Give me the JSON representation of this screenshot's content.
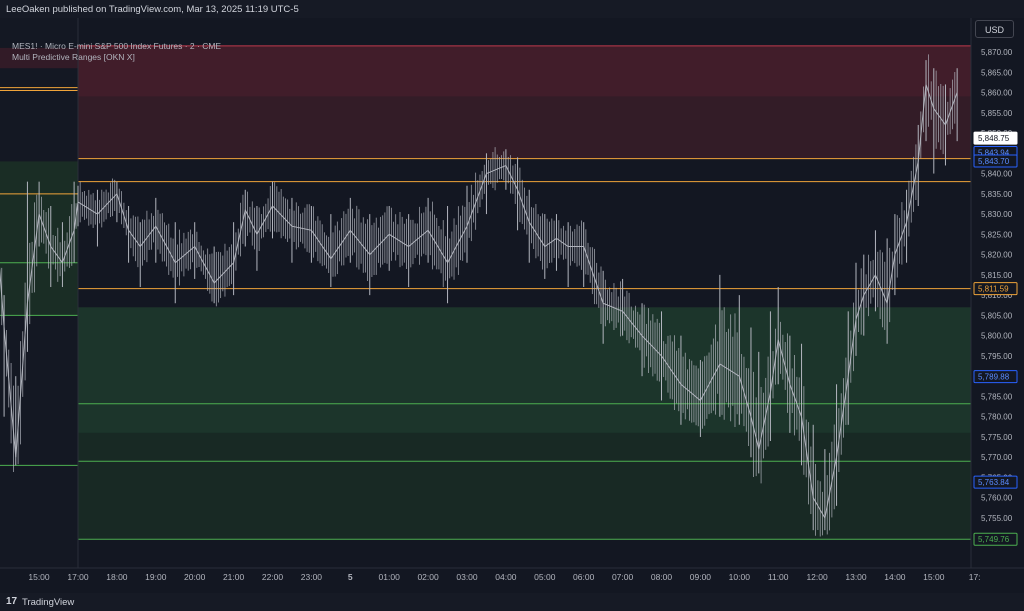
{
  "header": {
    "published_text": "LeeOaken published on TradingView.com, Mar 13, 2025 11:19 UTC-5"
  },
  "legend": {
    "symbol_line": "MES1! · Micro E-mini S&P 500 Index Futures · 2 · CME",
    "indicator_line": "Multi Predictive Ranges [OKN X]"
  },
  "toolbar": {
    "currency": "USD"
  },
  "footer": {
    "logo": "17",
    "brand": "TradingView"
  },
  "colors": {
    "background": "#131722",
    "price_line": "#b2b5be",
    "level_line": "#f0a43a",
    "resistance_zone": "#5a2430",
    "support_zone": "#1e3b2d",
    "support_line": "#4caf50",
    "blue_label": "#2962ff"
  },
  "chart_data": {
    "type": "line",
    "title": "MES1! · Micro E-mini S&P 500 Index Futures · 2 · CME",
    "x_ticks": [
      "15:00",
      "17:00",
      "18:00",
      "19:00",
      "20:00",
      "21:00",
      "22:00",
      "23:00",
      "5",
      "01:00",
      "02:00",
      "03:00",
      "04:00",
      "05:00",
      "06:00",
      "07:00",
      "08:00",
      "09:00",
      "10:00",
      "11:00",
      "12:00",
      "13:00",
      "14:00",
      "15:00",
      "17:"
    ],
    "y_ticks": [
      5755,
      5760,
      5765,
      5770,
      5775,
      5780,
      5785,
      5790,
      5795,
      5800,
      5805,
      5810,
      5815,
      5820,
      5825,
      5830,
      5835,
      5840,
      5845,
      5850,
      5855,
      5860,
      5865,
      5870
    ],
    "y_tick_labels": [
      "5,755.00",
      "5,760.00",
      "5,765.00",
      "5,770.00",
      "5,775.00",
      "5,780.00",
      "5,785.00",
      "5,790.00",
      "5,795.00",
      "5,800.00",
      "5,805.00",
      "5,810.00",
      "5,815.00",
      "5,820.00",
      "5,825.00",
      "5,830.00",
      "5,835.00",
      "5,840.00",
      "5,845.00",
      "5,850.00",
      "5,855.00",
      "5,860.00",
      "5,865.00",
      "5,870.00"
    ],
    "ylim": [
      5747,
      5874
    ],
    "series": [
      {
        "x": [
          14.2,
          14.5,
          14.8,
          15.1,
          15.4,
          15.7,
          16.0,
          16.3,
          16.6,
          16.9,
          17.0,
          17.5,
          18.0,
          18.3,
          18.6,
          19.0,
          19.5,
          20.0,
          20.5,
          21.0,
          21.3,
          21.6,
          22.0,
          22.5,
          23.0,
          23.5,
          24.0,
          24.5,
          25.0,
          25.5,
          26.0,
          26.5,
          27.0,
          27.5,
          28.0,
          28.3,
          28.6,
          29.0,
          29.3,
          29.6,
          30.0,
          30.5,
          31.0,
          31.5,
          32.0,
          32.5,
          33.0,
          33.5,
          34.0,
          34.3,
          34.5,
          34.8,
          35.0,
          35.3,
          35.6,
          35.9,
          36.2,
          36.5,
          36.8,
          37.0,
          37.2,
          37.5,
          37.8,
          38.0,
          38.3,
          38.6,
          38.8,
          39.0,
          39.3,
          39.6
        ],
        "y": [
          5850,
          5866,
          5840,
          5802,
          5770,
          5808,
          5830,
          5822,
          5818,
          5826,
          5833,
          5830,
          5835,
          5826,
          5822,
          5827,
          5818,
          5822,
          5813,
          5818,
          5831,
          5825,
          5832,
          5827,
          5826,
          5819,
          5826,
          5820,
          5825,
          5822,
          5826,
          5818,
          5827,
          5840,
          5842,
          5836,
          5828,
          5822,
          5824,
          5822,
          5822,
          5808,
          5806,
          5800,
          5795,
          5788,
          5784,
          5793,
          5790,
          5780,
          5772,
          5786,
          5799,
          5788,
          5780,
          5760,
          5755,
          5770,
          5790,
          5804,
          5810,
          5815,
          5808,
          5820,
          5828,
          5843,
          5862,
          5856,
          5852,
          5860
        ],
        "high": [
          5864,
          5870,
          5850,
          5810,
          5790,
          5838,
          5838,
          5832,
          5828,
          5838,
          5837,
          5836,
          5838,
          5832,
          5828,
          5834,
          5828,
          5828,
          5822,
          5828,
          5836,
          5832,
          5838,
          5834,
          5832,
          5830,
          5834,
          5830,
          5832,
          5830,
          5834,
          5832,
          5837,
          5845,
          5846,
          5844,
          5836,
          5830,
          5830,
          5828,
          5828,
          5816,
          5814,
          5808,
          5806,
          5800,
          5794,
          5815,
          5810,
          5802,
          5796,
          5806,
          5812,
          5800,
          5798,
          5778,
          5772,
          5788,
          5806,
          5818,
          5820,
          5826,
          5824,
          5830,
          5836,
          5852,
          5868,
          5866,
          5862,
          5866
        ],
        "low": [
          5842,
          5858,
          5815,
          5780,
          5768,
          5796,
          5822,
          5812,
          5812,
          5818,
          5827,
          5822,
          5828,
          5818,
          5812,
          5818,
          5808,
          5814,
          5808,
          5810,
          5822,
          5816,
          5824,
          5818,
          5818,
          5812,
          5818,
          5810,
          5816,
          5812,
          5818,
          5808,
          5818,
          5830,
          5836,
          5826,
          5818,
          5814,
          5816,
          5812,
          5812,
          5798,
          5800,
          5790,
          5784,
          5778,
          5775,
          5780,
          5778,
          5770,
          5766,
          5774,
          5788,
          5776,
          5768,
          5752,
          5752,
          5758,
          5778,
          5795,
          5800,
          5806,
          5798,
          5810,
          5818,
          5832,
          5848,
          5840,
          5842,
          5848
        ]
      }
    ],
    "zones": [
      {
        "name": "upper-resistance",
        "from": 5859,
        "to": 5871.5,
        "color": "#4a1f2c"
      },
      {
        "name": "lower-resistance",
        "from": 5843.7,
        "to": 5859,
        "color": "#3a1d28"
      },
      {
        "name": "upper-support",
        "from": 5776,
        "to": 5807,
        "color": "#1e3b2d"
      },
      {
        "name": "lower-support",
        "from": 5749.8,
        "to": 5776,
        "color": "#1a2d25"
      }
    ],
    "levels": [
      {
        "name": "r2",
        "value": 5871.5,
        "color": "#c0394b"
      },
      {
        "name": "avg-upper",
        "value": 5843.7,
        "color": "#f0a43a"
      },
      {
        "name": "avg",
        "value": 5838.0,
        "color": "#f0a43a"
      },
      {
        "name": "avg-lower",
        "value": 5811.59,
        "color": "#f0a43a"
      },
      {
        "name": "s1",
        "value": 5783.2,
        "color": "#4caf50"
      },
      {
        "name": "s2",
        "value": 5769.0,
        "color": "#4caf50"
      },
      {
        "name": "s3",
        "value": 5749.76,
        "color": "#4caf50"
      }
    ],
    "price_labels": [
      {
        "text": "5,848.75",
        "value": 5848.75,
        "style": "current"
      },
      {
        "text": "5,843.94",
        "value": 5845.2,
        "style": "blue"
      },
      {
        "text": "5,843.70",
        "value": 5843.1,
        "style": "blue"
      },
      {
        "text": "5,811.59",
        "value": 5811.59,
        "style": "orange"
      },
      {
        "text": "5,789.88",
        "value": 5789.88,
        "style": "blue"
      },
      {
        "text": "5,763.84",
        "value": 5763.84,
        "style": "blue"
      },
      {
        "text": "5,749.76",
        "value": 5749.76,
        "style": "green"
      }
    ]
  }
}
